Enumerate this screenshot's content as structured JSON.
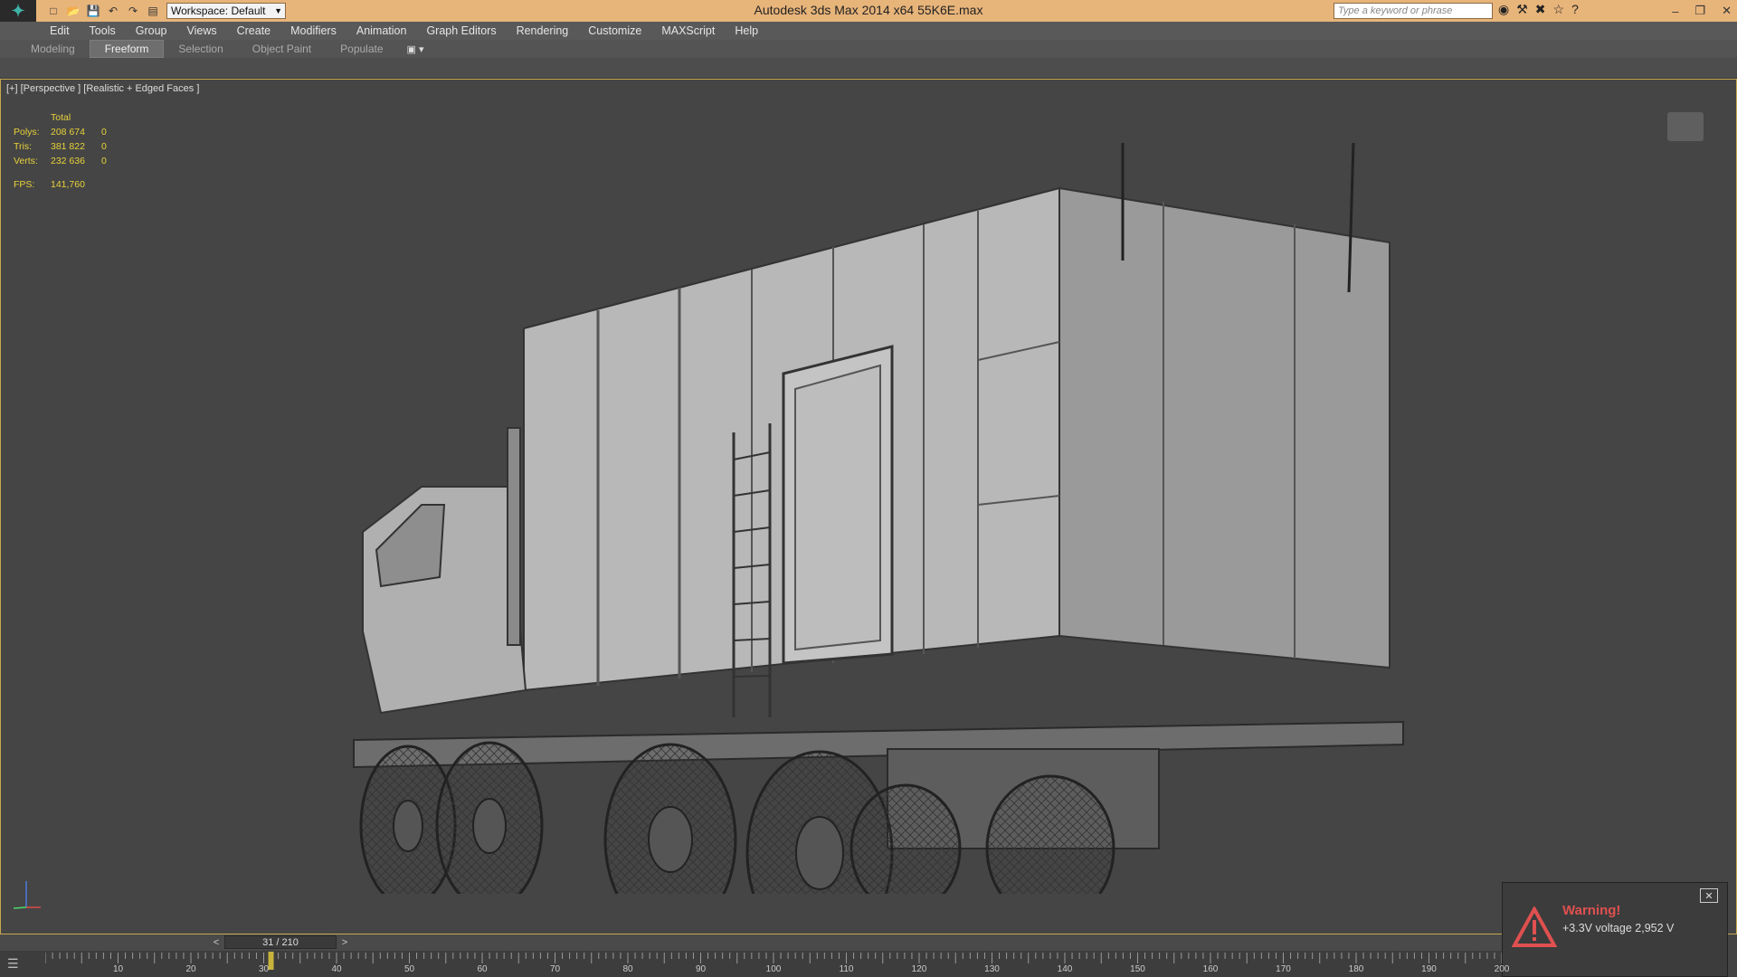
{
  "titlebar": {
    "workspace": "Workspace: Default",
    "title": "Autodesk 3ds Max  2014 x64      55K6E.max",
    "search_placeholder": "Type a keyword or phrase"
  },
  "menu": [
    "Edit",
    "Tools",
    "Group",
    "Views",
    "Create",
    "Modifiers",
    "Animation",
    "Graph Editors",
    "Rendering",
    "Customize",
    "MAXScript",
    "Help"
  ],
  "ribbon_tabs": [
    {
      "label": "Modeling",
      "active": false
    },
    {
      "label": "Freeform",
      "active": true
    },
    {
      "label": "Selection",
      "active": false
    },
    {
      "label": "Object Paint",
      "active": false
    },
    {
      "label": "Populate",
      "active": false
    }
  ],
  "viewport": {
    "label": "[+] [Perspective ] [Realistic + Edged Faces ]",
    "stats": {
      "header": "Total",
      "rows": [
        {
          "k": "Polys:",
          "v": "208 674",
          "s": "0"
        },
        {
          "k": "Tris:",
          "v": "381 822",
          "s": "0"
        },
        {
          "k": "Verts:",
          "v": "232 636",
          "s": "0"
        }
      ],
      "fps_label": "FPS:",
      "fps_value": "141,760"
    }
  },
  "warning": {
    "title": "Warning!",
    "message": "+3.3V voltage 2,952 V"
  },
  "timeslider": {
    "frame": "31 / 210",
    "prev": "<",
    "next": ">"
  },
  "ruler_ticks": [
    "10",
    "20",
    "30",
    "40",
    "50",
    "60",
    "70",
    "80",
    "90",
    "100",
    "110",
    "120",
    "130",
    "140",
    "150",
    "160",
    "170",
    "180",
    "190",
    "200"
  ],
  "colors": {
    "titlebar": "#e7b47a",
    "viewport_bg": "#454545",
    "stats": "#e8d23a",
    "warning_title": "#e05050"
  }
}
